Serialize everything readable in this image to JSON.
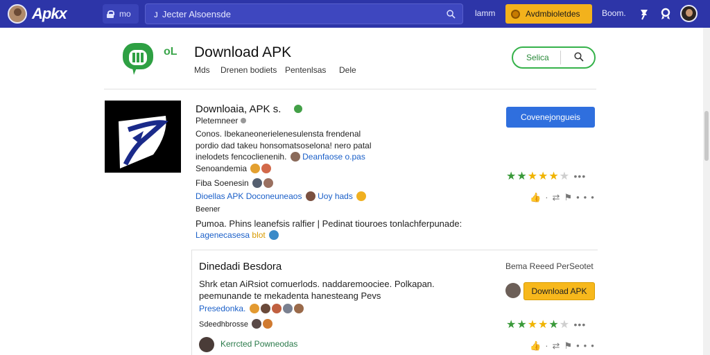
{
  "topbar": {
    "logo": "Apkx",
    "lock_label": "mo",
    "search_value": "Jecter Alsoensde",
    "nav_link": "lamm",
    "cta_label": "Avdmbioletdes",
    "menu_label": "Boom."
  },
  "header": {
    "title": "Download APK",
    "sub_icon_label": "oL",
    "tabs": [
      "Mds",
      "Drenen bodiets",
      "Pentenlsas",
      "Dele"
    ],
    "pill_label": "Selica"
  },
  "app": {
    "name": "Downloaia, APK s.",
    "developer": "Pletemneer",
    "desc_line1": "Conos. Ibekaneonerielenesulensta frendenal",
    "desc_line2": "pordio dad takeu honsomatsoselona! nero patal",
    "desc_line3": "inelodets fencoclienenih.",
    "desc_link": "Deanfaose o.pas",
    "meta_row1": "Senoandemia",
    "meta_row2": "Fiba Soenesin",
    "link_row1": "Dioellas APK",
    "link_row1b": "Doconeuneaos",
    "link_row1c": "Uoy hads",
    "meta_row3": "Beener",
    "summary": "Pumoa. Phins leanefsis ralfier | Pedinat tiouroes tonlachferpunade:",
    "link_row2": "Lagenecasesa",
    "link_row2b": "blot",
    "download_button": "Covenejongueis",
    "rating": 4.5
  },
  "card": {
    "title": "Dinedadi Besdora",
    "tag": "Bema Reeed PerSeotet",
    "desc_line1": "Shrk etan AiRsiot comuerlods. naddaremoociee. Polkapan.",
    "desc_line2": "peemunande te mekadenta hanesteang Pevs",
    "link_row": "Presedonka.",
    "meta_row": "Sdeedhbrosse",
    "download_button": "Download APK",
    "bottom_link": "Kerrcted Powneodas",
    "rating": 4.5
  },
  "colors": {
    "topbar": "#2d35a8",
    "accent_green": "#35b24a",
    "accent_blue": "#2f6fde",
    "accent_yellow": "#f7b81c"
  },
  "icons": [
    "lock-icon",
    "search-icon",
    "coin-icon",
    "pin-icon",
    "ribbon-icon",
    "user-icon",
    "verify-icon",
    "thumb-icon",
    "share-icon",
    "flag-icon",
    "more-icon"
  ]
}
